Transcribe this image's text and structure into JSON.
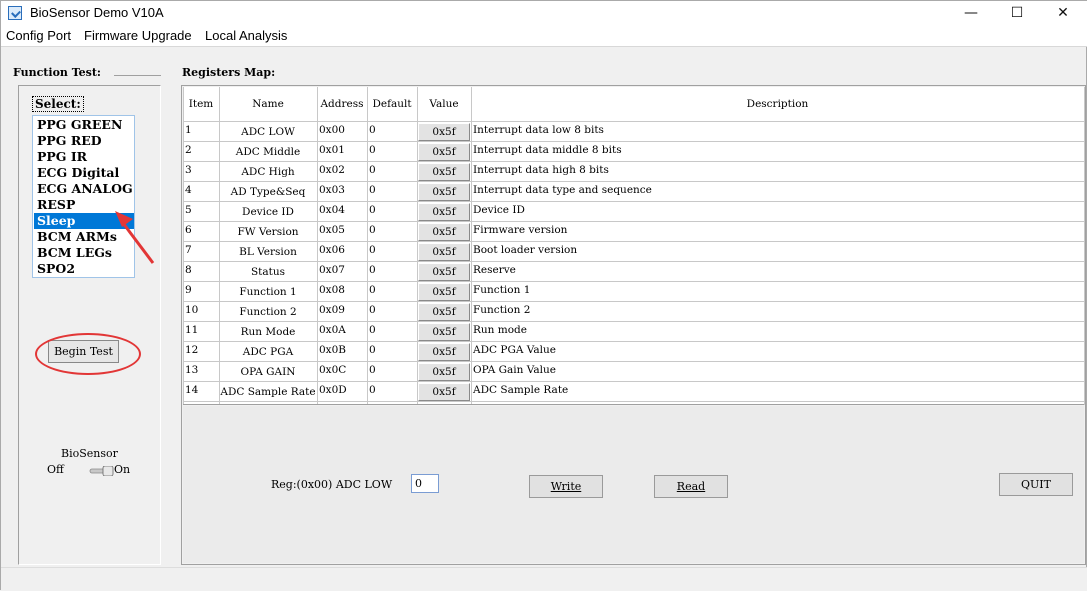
{
  "window": {
    "title": "BioSensor Demo V10A"
  },
  "menu": [
    "Config Port",
    "Firmware Upgrade",
    "Local Analysis"
  ],
  "function_test": {
    "label": "Function Test:",
    "select_label": "Select:",
    "items": [
      "PPG GREEN",
      "PPG RED",
      "PPG IR",
      "ECG Digital",
      "ECG ANALOG",
      "RESP",
      "Sleep",
      "BCM ARMs",
      "BCM LEGs",
      "SPO2"
    ],
    "selected": "Sleep",
    "begin_label": "Begin Test",
    "biosensor_label": "BioSensor",
    "off_label": "Off",
    "on_label": "On"
  },
  "registers": {
    "label": "Registers Map:",
    "headers": [
      "Item",
      "Name",
      "Address",
      "Default",
      "Value",
      "Description"
    ],
    "rows": [
      {
        "item": "1",
        "name": "ADC LOW",
        "address": "0x00",
        "default": "0",
        "value": "0x5f",
        "description": "Interrupt data low 8 bits"
      },
      {
        "item": "2",
        "name": "ADC Middle",
        "address": "0x01",
        "default": "0",
        "value": "0x5f",
        "description": "Interrupt data middle 8 bits"
      },
      {
        "item": "3",
        "name": "ADC High",
        "address": "0x02",
        "default": "0",
        "value": "0x5f",
        "description": "Interrupt data high 8 bits"
      },
      {
        "item": "4",
        "name": "AD Type&Seq",
        "address": "0x03",
        "default": "0",
        "value": "0x5f",
        "description": "Interrupt data type and sequence"
      },
      {
        "item": "5",
        "name": "Device ID",
        "address": "0x04",
        "default": "0",
        "value": "0x5f",
        "description": "Device ID"
      },
      {
        "item": "6",
        "name": "FW Version",
        "address": "0x05",
        "default": "0",
        "value": "0x5f",
        "description": "Firmware version"
      },
      {
        "item": "7",
        "name": "BL Version",
        "address": "0x06",
        "default": "0",
        "value": "0x5f",
        "description": "Boot loader version"
      },
      {
        "item": "8",
        "name": "Status",
        "address": "0x07",
        "default": "0",
        "value": "0x5f",
        "description": "Reserve"
      },
      {
        "item": "9",
        "name": "Function 1",
        "address": "0x08",
        "default": "0",
        "value": "0x5f",
        "description": "Function 1"
      },
      {
        "item": "10",
        "name": "Function 2",
        "address": "0x09",
        "default": "0",
        "value": "0x5f",
        "description": "Function 2"
      },
      {
        "item": "11",
        "name": "Run Mode",
        "address": "0x0A",
        "default": "0",
        "value": "0x5f",
        "description": "Run mode"
      },
      {
        "item": "12",
        "name": "ADC PGA",
        "address": "0x0B",
        "default": "0",
        "value": "0x5f",
        "description": "ADC PGA Value"
      },
      {
        "item": "13",
        "name": "OPA GAIN",
        "address": "0x0C",
        "default": "0",
        "value": "0x5f",
        "description": "OPA Gain Value"
      },
      {
        "item": "14",
        "name": "ADC Sample Rate",
        "address": "0x0D",
        "default": "0",
        "value": "0x5f",
        "description": "ADC Sample Rate"
      }
    ]
  },
  "controls": {
    "reg_label": "Reg:(0x00) ADC LOW",
    "reg_value": "0",
    "write_label": "Write",
    "read_label": "Read",
    "quit_label": "QUIT"
  },
  "colors": {
    "selection": "#0078d7",
    "annotation": "#e23636"
  }
}
